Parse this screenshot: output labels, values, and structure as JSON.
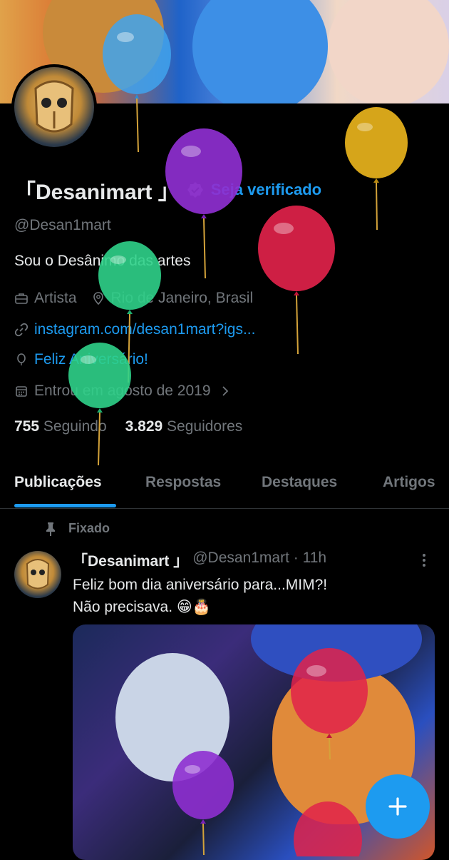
{
  "profile": {
    "name": "「Desanimart 」",
    "verify_cta": "Seja verificado",
    "handle": "@Desan1mart",
    "bio": "Sou o Desânimo das artes",
    "profession": "Artista",
    "location": "Rio de Janeiro, Brasil",
    "website": "instagram.com/desan1mart?igs...",
    "birthday": "Feliz Aniversário!",
    "joined": "Entrou em agosto de 2019",
    "following_count": "755",
    "following_label": "Seguindo",
    "followers_count": "3.829",
    "followers_label": "Seguidores"
  },
  "tabs": [
    "Publicações",
    "Respostas",
    "Destaques",
    "Artigos"
  ],
  "post": {
    "pinned_label": "Fixado",
    "author": "「Desanimart 」",
    "handle_time": "@Desan1mart · 11h",
    "text_line1": "Feliz bom dia aniversário para...MIM?!",
    "text_line2": "Não precisava. 😁🎂"
  },
  "colors": {
    "accent": "#1d9bf0",
    "background": "#000000",
    "text_primary": "#e7e9ea",
    "text_secondary": "#71767b"
  },
  "icons": [
    "briefcase-icon",
    "location-pin-icon",
    "link-icon",
    "balloon-icon",
    "calendar-icon",
    "chevron-right-icon",
    "pin-icon",
    "more-vertical-icon",
    "plus-icon",
    "verified-badge-icon"
  ]
}
